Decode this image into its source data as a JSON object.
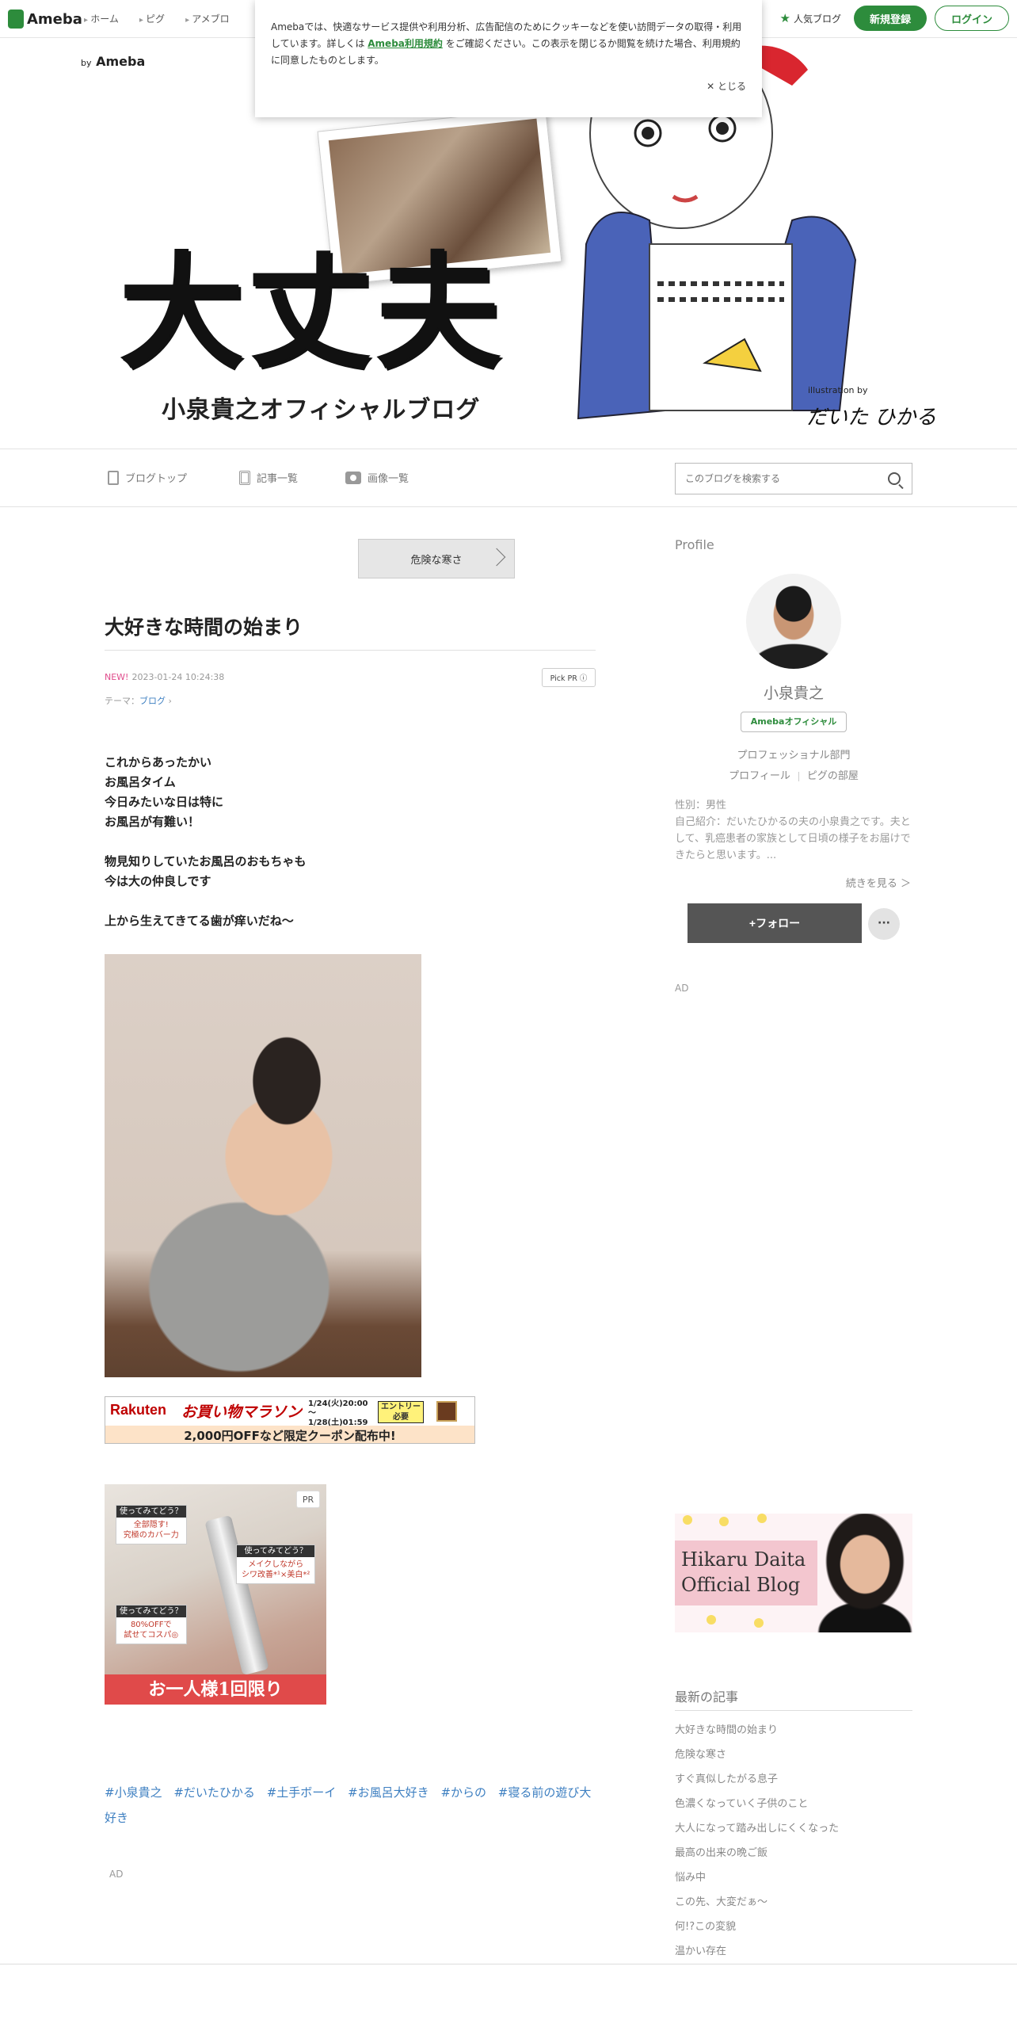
{
  "topbar": {
    "logo": "Ameba",
    "nav": [
      "ホーム",
      "ピグ",
      "アメブロ"
    ],
    "popular": "人気ブログ",
    "signup": "新規登録",
    "login": "ログイン"
  },
  "cookie": {
    "text_before": "Amebaでは、快適なサービス提供や利用分析、広告配信のためにクッキーなどを使い訪問データの取得・利用しています。詳しくは ",
    "link": "Ameba利用規約",
    "text_after": " をご確認ください。この表示を閉じるか閲覧を続けた場合、利用規約に同意したものとします。",
    "close": "とじる"
  },
  "banner": {
    "by": "by",
    "brand": "Ameba",
    "title": "大丈夫",
    "subtitle": "小泉貴之オフィシャルブログ",
    "illust_by": "illustration by",
    "illust_name": "だいた ひかる"
  },
  "blognav": {
    "items": [
      "ブログトップ",
      "記事一覧",
      "画像一覧"
    ],
    "search_placeholder": "このブログを検索する"
  },
  "article": {
    "prev_label": "危険な寒さ",
    "title": "大好きな時間の始まり",
    "new_badge": "NEW!",
    "datetime": "2023-01-24 10:24:38",
    "pickpr": "Pick PR ⓘ",
    "theme_label": "テーマ：",
    "theme": "ブログ",
    "body": "これからあったかい\nお風呂タイム\n今日みたいな日は特に\nお風呂が有難い！\n\n物見知りしていたお風呂のおもちゃも\n今は大の仲良しです\n\n上から生えてきてる歯が痒いだね〜",
    "hashtags": [
      "#小泉貴之",
      "#だいたひかる",
      "#土手ボーイ",
      "#お風呂大好き",
      "#からの",
      "#寝る前の遊び大好き"
    ],
    "ad_label": "AD"
  },
  "rakuten": {
    "logo": "Rakuten",
    "title": "お買い物マラソン",
    "dates": "1/24(火)20:00\n〜\n1/28(土)01:59",
    "entry": "エントリー\n必要",
    "bottom": "2,000円OFFなど限定クーポン配布中!"
  },
  "pr_ad": {
    "tag": "PR",
    "b1_q": "使ってみてどう？",
    "b1": "全部隠す!\n究極のカバー力",
    "b2_q": "使ってみてどう？",
    "b2": "メイクしながら\nシワ改善*¹×美白*²",
    "b3_q": "使ってみてどう？",
    "b3": "80%OFFで\n試せてコスパ◎",
    "bottom": "お一人様1回限り"
  },
  "sidebar": {
    "profile_heading": "Profile",
    "name": "小泉貴之",
    "official": "Amebaオフィシャル",
    "category": "プロフェッショナル部門",
    "link_profile": "プロフィール",
    "link_pig": "ピグの部屋",
    "detail": "性別：男性\n自己紹介：だいたひかるの夫の小泉貴之です。夫として、乳癌患者の家族として日頃の様子をお届けできたらと思います。...",
    "more": "続きを見る ＞",
    "follow": "+フォロー",
    "dots": "···",
    "ad_label": "AD",
    "hikaru_banner": "Hikaru Daita\nOfficial Blog",
    "latest_heading": "最新の記事",
    "latest": [
      "大好きな時間の始まり",
      "危険な寒さ",
      "すぐ真似したがる息子",
      "色濃くなっていく子供のこと",
      "大人になって踏み出しにくくなった",
      "最高の出来の晩ご飯",
      "悩み中",
      "この先、大変だぁ〜",
      "何!?この変貌",
      "温かい存在"
    ]
  }
}
